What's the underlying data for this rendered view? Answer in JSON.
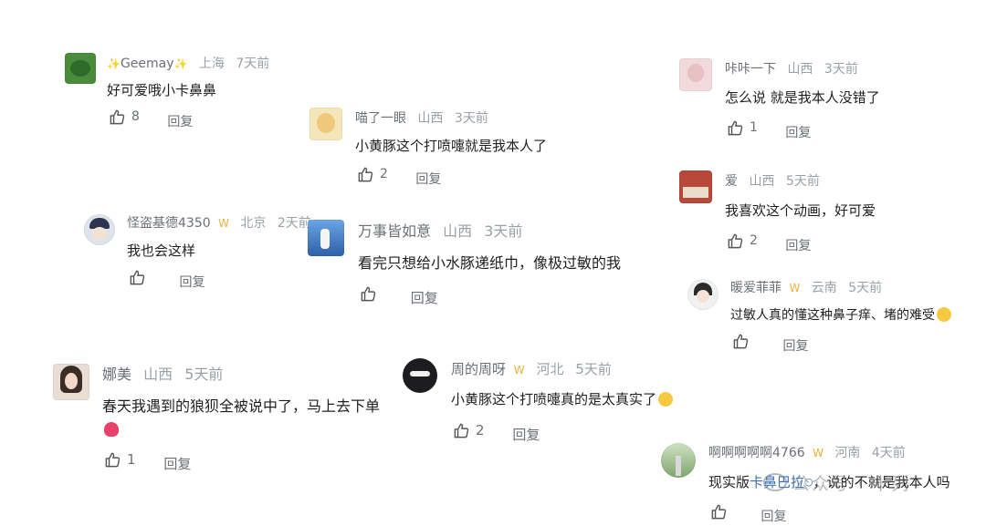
{
  "comments": [
    {
      "nick": "Geemay",
      "badge": "",
      "location": "上海",
      "time": "7天前",
      "text": "好可爱哦小卡鼻鼻",
      "likes": "8",
      "reply": "回复"
    },
    {
      "nick": "喵了一眼",
      "badge": "",
      "location": "山西",
      "time": "3天前",
      "text": "小黄豚这个打喷嚏就是我本人了",
      "likes": "2",
      "reply": "回复"
    },
    {
      "nick": "咔咔一下",
      "badge": "",
      "location": "山西",
      "time": "3天前",
      "text": "怎么说 就是我本人没错了",
      "likes": "1",
      "reply": "回复"
    },
    {
      "nick": "爱",
      "badge": "",
      "location": "山西",
      "time": "5天前",
      "text": "我喜欢这个动画，好可爱",
      "likes": "2",
      "reply": "回复"
    },
    {
      "nick": "怪盗基德4350",
      "badge": "W",
      "location": "北京",
      "time": "2天前",
      "text": "我也会这样",
      "likes": "",
      "reply": "回复"
    },
    {
      "nick": "万事皆如意",
      "badge": "",
      "location": "山西",
      "time": "3天前",
      "text": "看完只想给小水豚递纸巾，像极过敏的我",
      "likes": "",
      "reply": "回复"
    },
    {
      "nick": "暖爱菲菲",
      "badge": "W",
      "location": "云南",
      "time": "5天前",
      "text": "过敏人真的懂这种鼻子痒、堵的难受",
      "likes": "",
      "reply": "回复"
    },
    {
      "nick": "娜美",
      "badge": "",
      "location": "山西",
      "time": "5天前",
      "text": "春天我遇到的狼狈全被说中了，马上去下单",
      "likes": "1",
      "reply": "回复"
    },
    {
      "nick": "周的周呀",
      "badge": "W",
      "location": "河北",
      "time": "5天前",
      "text": "小黄豚这个打喷嚏真的是太真实了",
      "likes": "2",
      "reply": "回复"
    },
    {
      "nick": "啊啊啊啊啊4766",
      "badge": "W",
      "location": "河南",
      "time": "4天前",
      "text_pre": "现实版",
      "text_link": "卡鼻巴拉",
      "text_post": "，说的不就是我本人吗",
      "likes": "",
      "reply": "回复"
    }
  ],
  "watermark": "公众号 · 十列",
  "colors": {
    "meta": "#9aa0a6",
    "text": "#1f1f1f",
    "badge": "#e7b23a",
    "link": "#3b6fb6"
  }
}
